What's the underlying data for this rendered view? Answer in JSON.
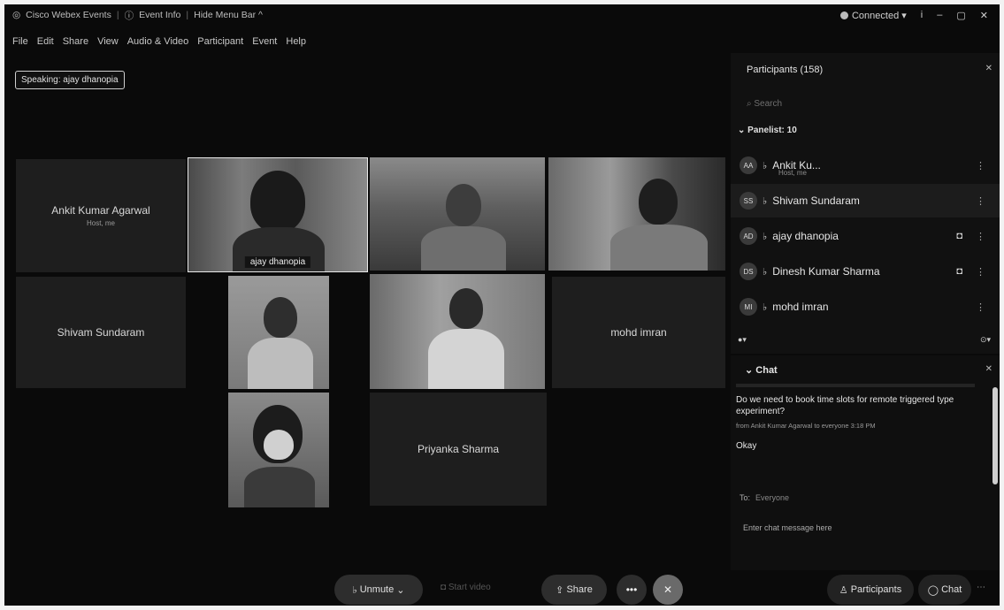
{
  "titlebar": {
    "app_title": "Cisco Webex Events",
    "event_info": "Event Info",
    "hide_menu": "Hide Menu Bar ^",
    "connected": "Connected",
    "connected_arrow": "▾",
    "info_icon": "i",
    "minimize": "–",
    "restore": "▢",
    "close": "✕"
  },
  "menubar": [
    "File",
    "Edit",
    "Share",
    "View",
    "Audio & Video",
    "Participant",
    "Event",
    "Help"
  ],
  "speaking": "Speaking: ajay dhanopia",
  "tiles": {
    "ankit": {
      "name": "Ankit Kumar Agarwal",
      "sub": "Host, me"
    },
    "ajay": {
      "name": "ajay dhanopia"
    },
    "shivam": {
      "name": "Shivam Sundaram"
    },
    "mohd": {
      "name": "mohd imran"
    },
    "priyanka": {
      "name": "Priyanka Sharma"
    }
  },
  "participants": {
    "title": "Participants (158)",
    "close": "✕",
    "search_placeholder": "Search",
    "section": "Panelist: 10",
    "rows": [
      {
        "initials": "AA",
        "name": "Ankit Ku...",
        "sub": "Host, me"
      },
      {
        "initials": "SS",
        "name": "Shivam Sundaram"
      },
      {
        "initials": "AD",
        "name": "ajay dhanopia"
      },
      {
        "initials": "DS",
        "name": "Dinesh Kumar Sharma"
      },
      {
        "initials": "MI",
        "name": "mohd imran"
      }
    ],
    "more": "⋮"
  },
  "chat": {
    "title": "Chat",
    "close": "✕",
    "message": "Do we need to book time slots for remote triggered type experiment?",
    "meta": "from Ankit Kumar Agarwal to everyone   3:18 PM",
    "reply": "Okay",
    "to_label": "To:",
    "to_value": "Everyone",
    "input_placeholder": "Enter chat message here"
  },
  "toolbar": {
    "unmute": "Unmute",
    "start_video": "Start video",
    "share": "Share",
    "participants": "Participants",
    "chat": "Chat"
  }
}
